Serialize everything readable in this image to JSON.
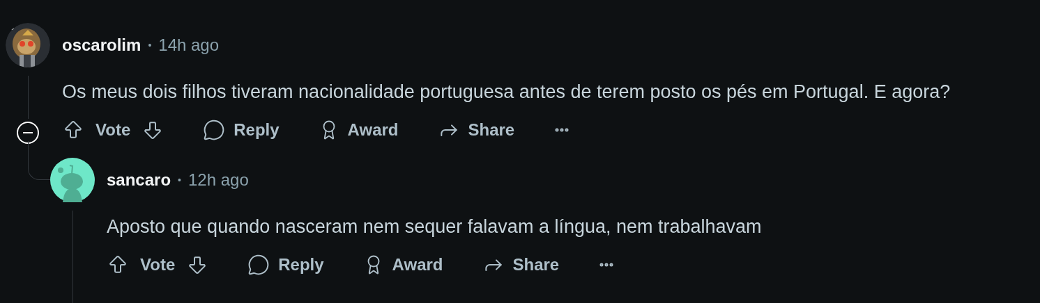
{
  "comments": [
    {
      "author": "oscarolim",
      "separator": "•",
      "time": "14h ago",
      "avatar": {
        "kind": "illustrated"
      },
      "body": "Os meus dois filhos tiveram nacionalidade portuguesa antes de terem posto os pés em Portugal. E agora?",
      "collapse": {
        "expanded": true
      },
      "actions": {
        "vote": "Vote",
        "reply": "Reply",
        "award": "Award",
        "share": "Share"
      },
      "has_replies": true
    },
    {
      "author": "sancaro",
      "separator": "•",
      "time": "12h ago",
      "avatar": {
        "kind": "default"
      },
      "body": "Aposto que quando nasceram nem sequer falavam a língua, nem trabalhavam",
      "actions": {
        "vote": "Vote",
        "reply": "Reply",
        "award": "Award",
        "share": "Share"
      },
      "has_replies": true
    }
  ]
}
